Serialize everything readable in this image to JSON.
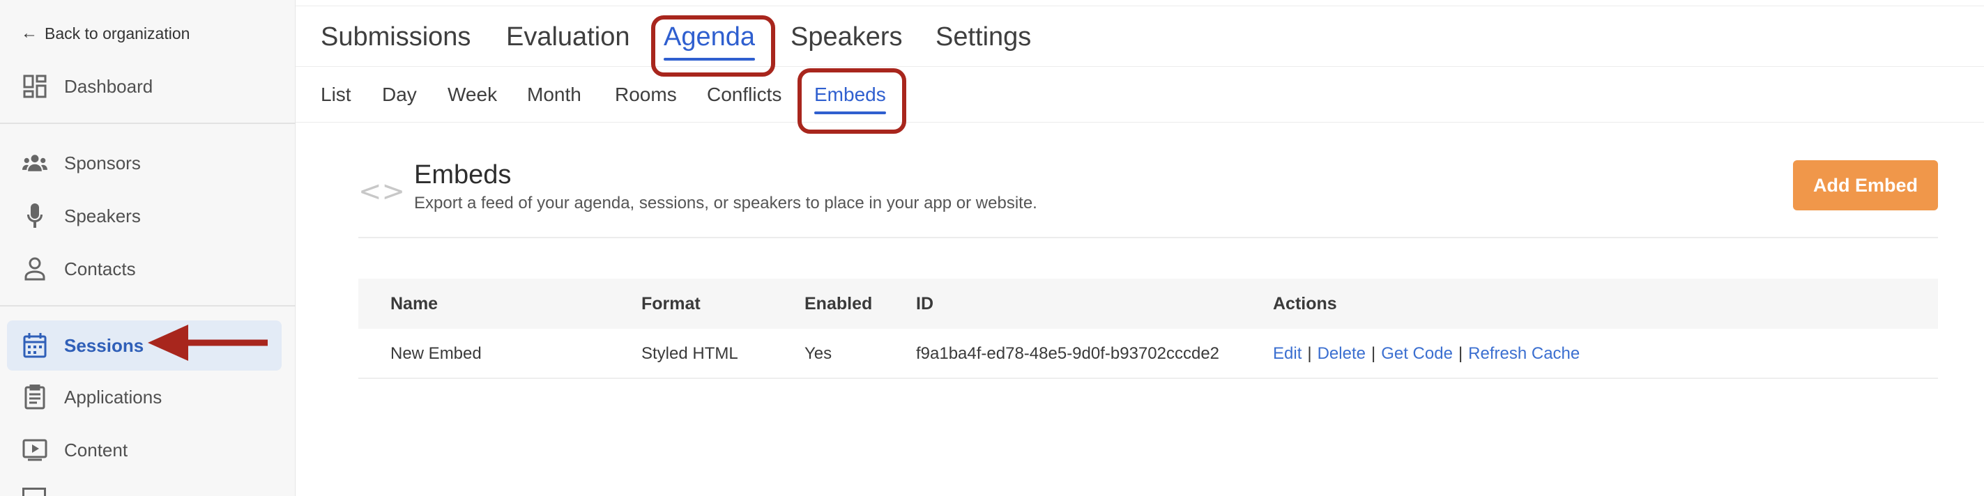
{
  "sidebar": {
    "back_label": "Back to organization",
    "items": [
      {
        "label": "Dashboard",
        "icon": "dashboard-icon"
      },
      {
        "label": "Sponsors",
        "icon": "people-icon"
      },
      {
        "label": "Speakers",
        "icon": "microphone-icon"
      },
      {
        "label": "Contacts",
        "icon": "person-icon"
      },
      {
        "label": "Sessions",
        "icon": "calendar-icon",
        "active": true
      },
      {
        "label": "Applications",
        "icon": "clipboard-icon"
      },
      {
        "label": "Content",
        "icon": "video-icon"
      }
    ]
  },
  "top_tabs": [
    "Submissions",
    "Evaluation",
    "Agenda",
    "Speakers",
    "Settings"
  ],
  "active_top_tab": "Agenda",
  "sub_tabs": [
    "List",
    "Day",
    "Week",
    "Month",
    "Rooms",
    "Conflicts",
    "Embeds"
  ],
  "active_sub_tab": "Embeds",
  "section": {
    "title": "Embeds",
    "subtitle": "Export a feed of your agenda, sessions, or speakers to place in your app or website.",
    "add_button": "Add Embed"
  },
  "table": {
    "headers": [
      "Name",
      "Format",
      "Enabled",
      "ID",
      "Actions"
    ],
    "rows": [
      {
        "name": "New Embed",
        "format": "Styled HTML",
        "enabled": "Yes",
        "id": "f9a1ba4f-ed78-48e5-9d0f-b93702cccde2",
        "actions": [
          "Edit",
          "Delete",
          "Get Code",
          "Refresh Cache"
        ]
      }
    ]
  },
  "colors": {
    "accent": "#2f5fcf",
    "annotation": "#a8261d",
    "button": "#f0974a",
    "active_bg": "#e3ebf6"
  }
}
